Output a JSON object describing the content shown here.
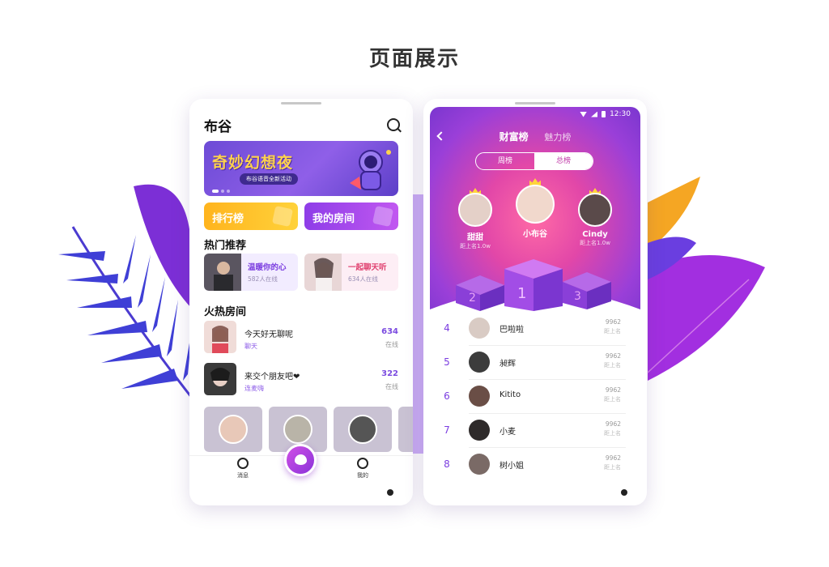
{
  "page": {
    "title": "页面展示"
  },
  "left_phone": {
    "app_title": "布谷",
    "banner": {
      "title": "奇妙幻想夜",
      "subtitle": "布谷语音全新活动"
    },
    "entries": {
      "rank": "排行榜",
      "my_rooms": "我的房间"
    },
    "hot_section_title": "热门推荐",
    "hot_cards": [
      {
        "name": "温暖你的心",
        "count": "582人在线"
      },
      {
        "name": "一起聊天听",
        "count": "634人在线"
      }
    ],
    "rooms_section_title": "火热房间",
    "rooms": [
      {
        "name": "今天好无聊呢",
        "tag": "聊天",
        "count": "634",
        "unit": "在线"
      },
      {
        "name": "来交个朋友吧❤",
        "tag": "连麦嗨",
        "count": "322",
        "unit": "在线"
      }
    ],
    "tabbar": {
      "messages": "消息",
      "mine": "我的"
    }
  },
  "right_phone": {
    "status_time": "12:30",
    "tabs": {
      "wealth": "财富榜",
      "charm": "魅力榜"
    },
    "segment": {
      "week": "周榜",
      "total": "总榜"
    },
    "top3": [
      {
        "rank": "2",
        "name": "甜甜",
        "distance": "距上名1.0w"
      },
      {
        "rank": "1",
        "name": "小布谷",
        "distance": ""
      },
      {
        "rank": "3",
        "name": "Cindy",
        "distance": "距上名1.0w"
      }
    ],
    "list": [
      {
        "rank": "4",
        "name": "巴啦啦",
        "value": "9962",
        "gap": "距上名"
      },
      {
        "rank": "5",
        "name": "昶辉",
        "value": "9962",
        "gap": "距上名"
      },
      {
        "rank": "6",
        "name": "Kitito",
        "value": "9962",
        "gap": "距上名"
      },
      {
        "rank": "7",
        "name": "小麦",
        "value": "9962",
        "gap": "距上名"
      },
      {
        "rank": "8",
        "name": "树小姐",
        "value": "9962",
        "gap": "距上名"
      }
    ]
  },
  "colors": {
    "primary_purple": "#8a3de6",
    "rank_yellow": "#ffc226",
    "pink": "#e0406f"
  }
}
